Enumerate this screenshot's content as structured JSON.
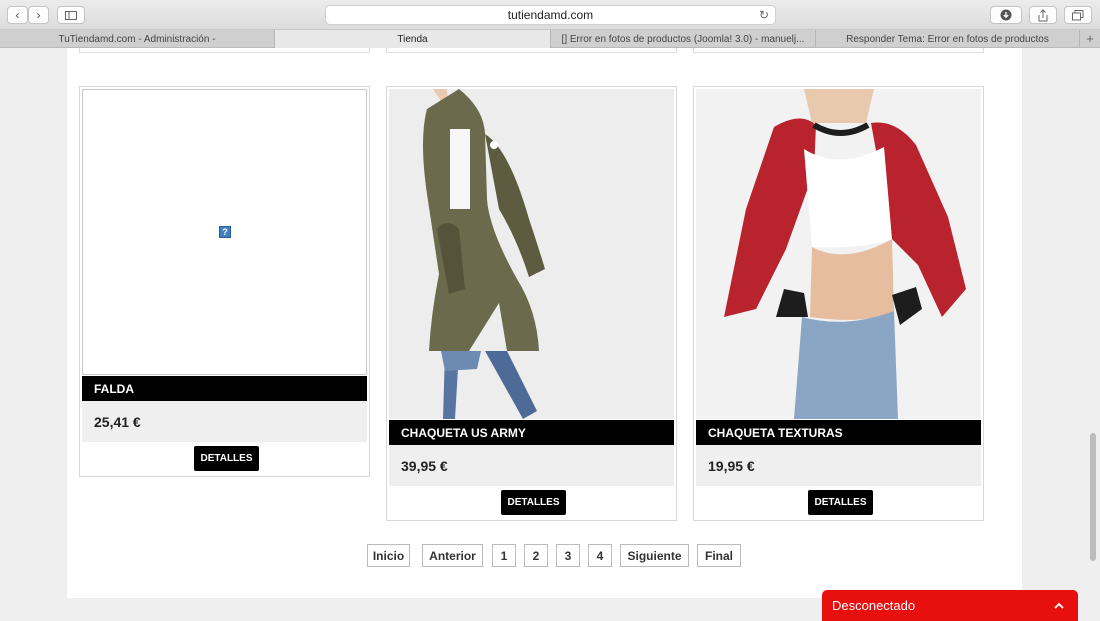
{
  "browser": {
    "url": "tutiendamd.com",
    "tabs": [
      "TuTiendamd.com - Administración -",
      "Tienda",
      "[] Error en fotos de productos (Joomla! 3.0) - manuelj...",
      "Responder Tema: Error en fotos de productos"
    ],
    "active_tab": 1
  },
  "products": [
    {
      "name": "FALDA",
      "price": "25,41 €",
      "button": "DETALLES",
      "image": "broken-image"
    },
    {
      "name": "CHAQUETA US ARMY",
      "price": "39,95 €",
      "button": "DETALLES",
      "image": "olive-jacket-photo"
    },
    {
      "name": "CHAQUETA TEXTURAS",
      "price": "19,95 €",
      "button": "DETALLES",
      "image": "red-bomber-photo"
    }
  ],
  "pagination": [
    "Inicio",
    "Anterior",
    "1",
    "2",
    "3",
    "4",
    "Siguiente",
    "Final"
  ],
  "chat": {
    "status": "Desconectado"
  },
  "colors": {
    "accent": "#e8100f",
    "name_bar": "#000000",
    "price_bg": "#efefef"
  }
}
